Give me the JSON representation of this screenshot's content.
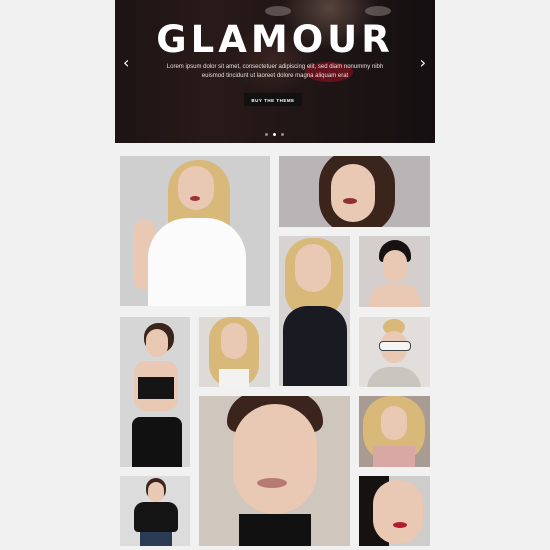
{
  "hero": {
    "title": "GLAMOUR",
    "text_line1": "Lorem ipsum dolor sit amet, consectetuer adipiscing elit, sed diam nonummy nibh",
    "text_line2": "euismod tincidunt ut laoreet dolore magna aliquam erat",
    "button_label": "BUY THE THEME",
    "prev_arrow": "‹",
    "next_arrow": "›",
    "slide_count": 3,
    "active_slide": 2
  },
  "gallery": {
    "photos": [
      {
        "name": "photo-blonde-white-dress",
        "description_icon": "portrait-photo"
      },
      {
        "name": "photo-brunette-closeup"
      },
      {
        "name": "photo-blonde-black-sequins"
      },
      {
        "name": "photo-short-dark-hair"
      },
      {
        "name": "photo-brunette-black-top"
      },
      {
        "name": "photo-long-blonde-hair"
      },
      {
        "name": "photo-sunglasses-bun"
      },
      {
        "name": "photo-large-face-closeup"
      },
      {
        "name": "photo-curly-blonde"
      },
      {
        "name": "photo-black-tshirt"
      },
      {
        "name": "photo-asian-red-lips"
      }
    ]
  },
  "colors": {
    "page_background": "#f1f1f1",
    "hero_dark": "#2a1c1c",
    "button_background": "#111111",
    "lip_red": "#a01828"
  }
}
